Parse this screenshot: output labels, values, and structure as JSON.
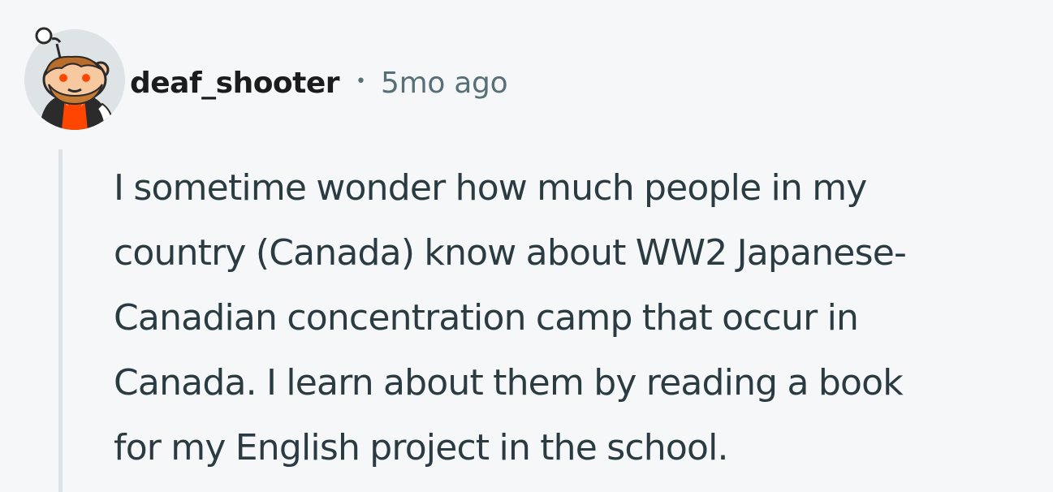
{
  "comment": {
    "author": "deaf_shooter",
    "separator": "•",
    "timestamp": "5mo ago",
    "body": "I sometime wonder how much people in my\ncountry (Canada) know about WW2 Japanese-\nCanadian concentration camp that occur in\nCanada. I learn about them by reading a book\nfor my English project in the school."
  },
  "icons": {
    "avatar": "snoo-avatar-icon"
  },
  "colors": {
    "background": "#f6f7f8",
    "username": "#1c1c1c",
    "meta": "#576f76",
    "body_text": "#2a3c42",
    "thread_line": "#dde3e7",
    "avatar_bg": "#dee3e6",
    "avatar_shirt": "#ff4500"
  }
}
